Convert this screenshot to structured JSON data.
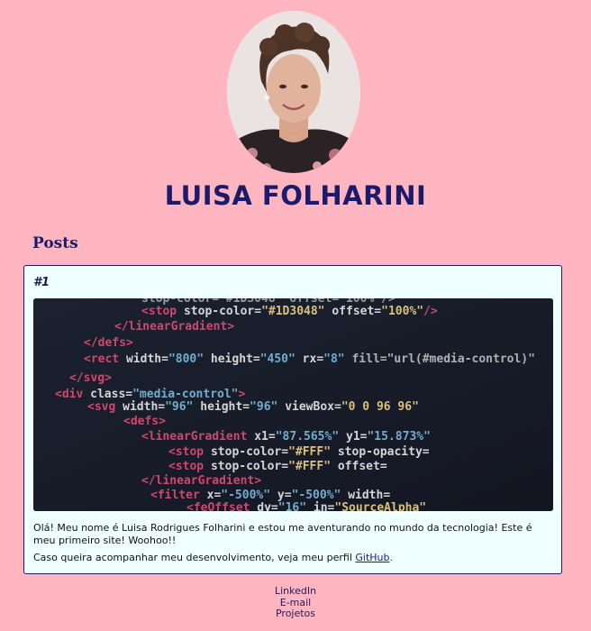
{
  "profile": {
    "name": "LUISA FOLHARINI",
    "avatar_icon": "profile-photo"
  },
  "posts": {
    "heading": "Posts",
    "items": [
      {
        "number": "#1",
        "image_icon": "code-screenshot-image",
        "text": "Olá! Meu nome é Luisa Rodrigues Folharini e estou me aventurando no mundo da tecnologia! Este é meu primeiro site! Woohoo!!",
        "follow_text": "Caso queira acompanhar meu desenvolvimento, veja meu perfil ",
        "link_label": "GitHub",
        "follow_end": "."
      }
    ]
  },
  "footer": {
    "links": [
      "LinkedIn",
      "E-mail",
      "Projetos"
    ]
  },
  "colors": {
    "background": "#ffb6c1",
    "card": "#f0ffff",
    "heading": "#1b1a6b"
  }
}
